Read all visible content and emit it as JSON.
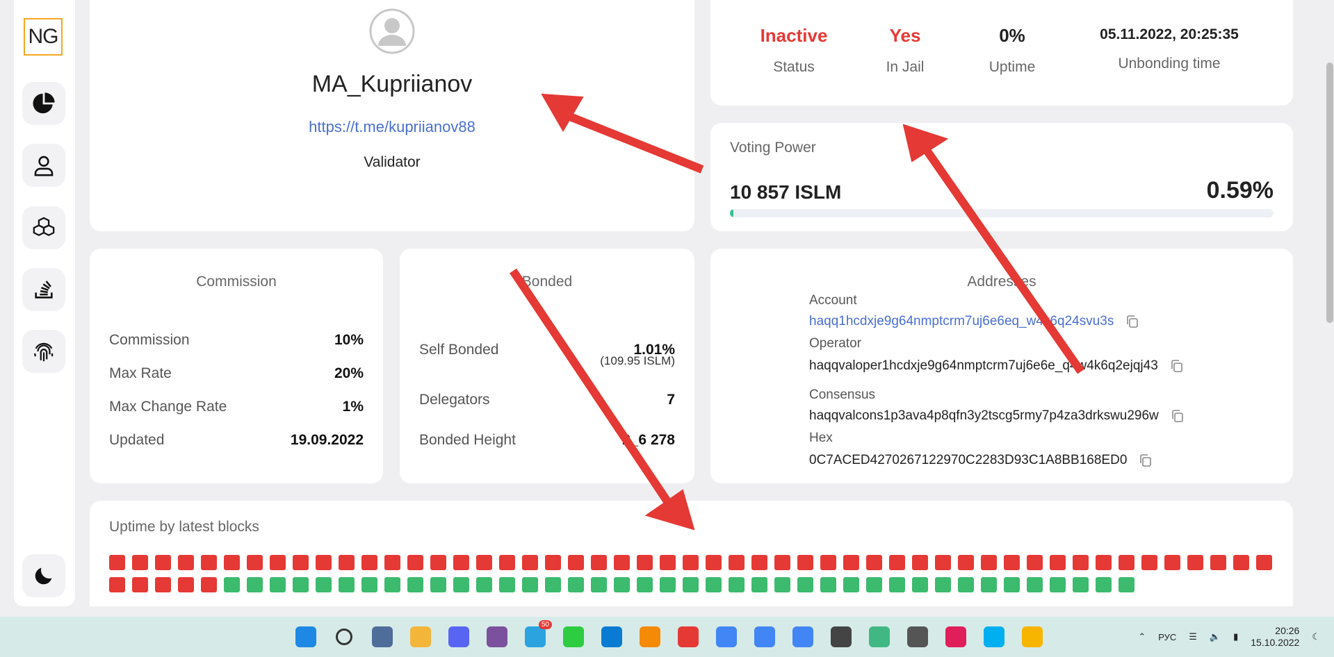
{
  "sidebar": {
    "logo": "NG",
    "items": [
      {
        "icon": "pie-chart-icon"
      },
      {
        "icon": "user-icon"
      },
      {
        "icon": "cubes-icon"
      },
      {
        "icon": "stack-icon"
      },
      {
        "icon": "fingerprint-icon"
      }
    ],
    "theme_icon": "moon-icon"
  },
  "profile": {
    "name": "MA_Kupriianov",
    "link": "https://t.me/kupriianov88",
    "role": "Validator"
  },
  "status": {
    "status_value": "Inactive",
    "status_label": "Status",
    "jail_value": "Yes",
    "jail_label": "In Jail",
    "uptime_value": "0%",
    "uptime_label": "Uptime",
    "unbonding_value": "05.11.2022, 20:25:35",
    "unbonding_label": "Unbonding time"
  },
  "voting": {
    "title": "Voting Power",
    "amount": "10 857 ISLM",
    "percent": "0.59%",
    "fill_fraction": 0.0059
  },
  "commission": {
    "title": "Commission",
    "rows": [
      {
        "label": "Commission",
        "value": "10%"
      },
      {
        "label": "Max Rate",
        "value": "20%"
      },
      {
        "label": "Max Change Rate",
        "value": "1%"
      },
      {
        "label": "Updated",
        "value": "19.09.2022"
      }
    ]
  },
  "bonded": {
    "title": "Bonded",
    "self_label": "Self Bonded",
    "self_value": "1.01%",
    "self_sub": "(109.95 ISLM)",
    "delegators_label": "Delegators",
    "delegators_value": "7",
    "height_label": "Bonded Height",
    "height_value": "2_6 278"
  },
  "addresses": {
    "title": "Addresses",
    "account_label": "Account",
    "account_value": "haqq1hcdxje9g64nmptcrm7uj6e6eq_w4k6q24svu3s",
    "operator_label": "Operator",
    "operator_value": "haqqvaloper1hcdxje9g64nmptcrm7uj6e6e_q4w4k6q2ejqj43",
    "consensus_label": "Consensus",
    "consensus_value": "haqqvalcons1p3ava4p8qfn3y2tscg5rmy7p4za3drkswu296w",
    "hex_label": "Hex",
    "hex_value": "0C7ACED4270267122970C2283D93C1A8BB168ED0"
  },
  "uptime": {
    "title": "Uptime by latest blocks",
    "missed_color": "#e53935",
    "signed_color": "#3cba6e",
    "row1_missed": 52,
    "row2_missed": 4,
    "row2_signed": 40
  },
  "taskbar": {
    "lang": "РУС",
    "time": "20:26",
    "date": "15.10.2022",
    "apps": [
      "windows-start-icon",
      "search-icon",
      "explorer-remote-icon",
      "folder-icon",
      "discord-icon",
      "viber-icon",
      "telegram-icon",
      "app-green-icon",
      "vscode-icon",
      "sublime-icon",
      "yandex-browser-icon",
      "chrome-icon",
      "chrome-b-icon",
      "chrome-d-icon",
      "terminal-icon",
      "git-icon",
      "calculator-icon",
      "slack-icon",
      "skype-icon",
      "music-icon"
    ],
    "telegram_badge": "50"
  }
}
